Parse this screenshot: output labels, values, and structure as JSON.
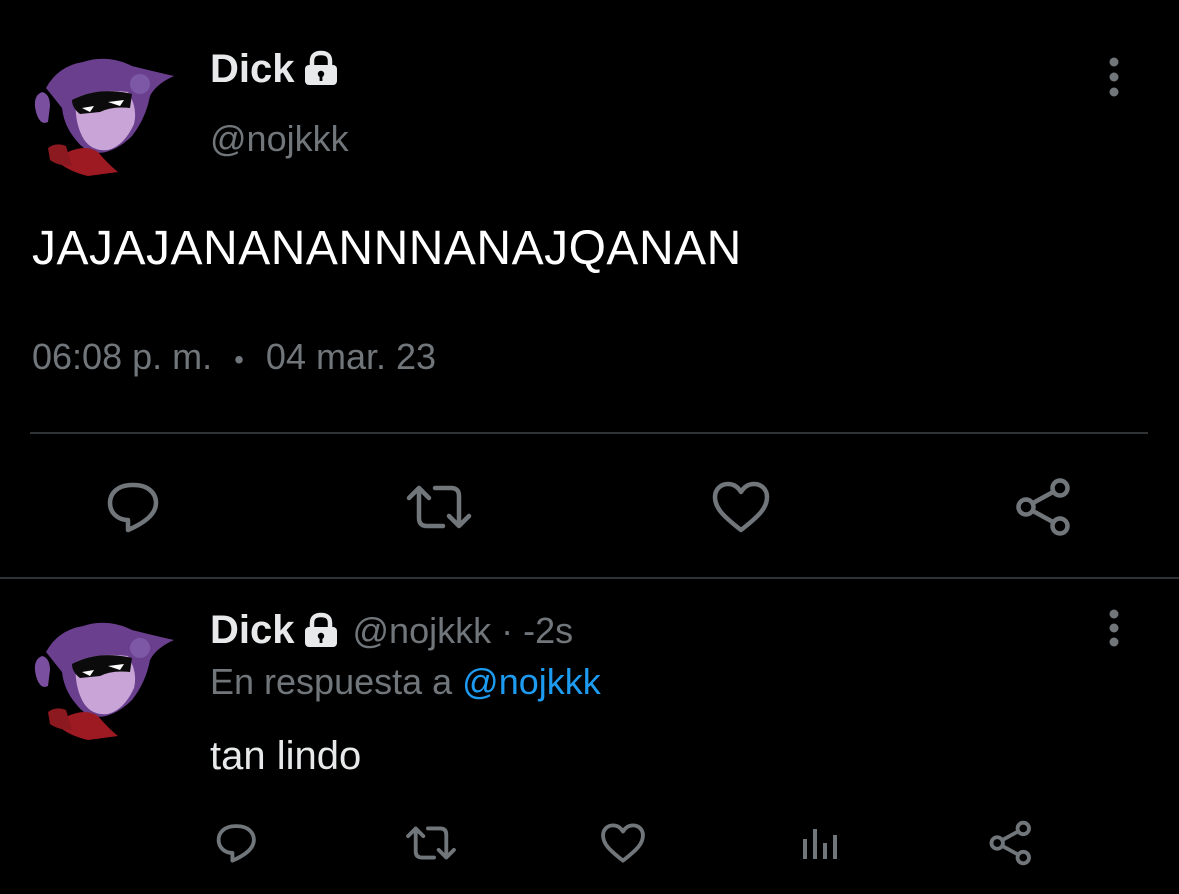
{
  "main_tweet": {
    "display_name": "Dick",
    "handle": "@nojkkk",
    "text": "JAJAJANANANNNANAJQANAN",
    "time": "06:08 p. m.",
    "separator": "•",
    "date": "04 mar. 23"
  },
  "reply_tweet": {
    "display_name": "Dick",
    "handle": "@nojkkk",
    "time": " · -2s",
    "in_reply_to_label": "En respuesta a",
    "in_reply_to_mention": "@nojkkk",
    "text": "tan lindo"
  },
  "icons": {
    "lock": "lock-icon",
    "more": "more-vertical-icon",
    "reply": "reply-icon",
    "retweet": "retweet-icon",
    "like": "heart-icon",
    "share": "share-icon",
    "stats": "stats-icon"
  },
  "colors": {
    "background": "#000000",
    "text_primary": "#e7e9ea",
    "text_secondary": "#71767b",
    "link": "#1d9bf0",
    "divider": "#2f3336"
  }
}
